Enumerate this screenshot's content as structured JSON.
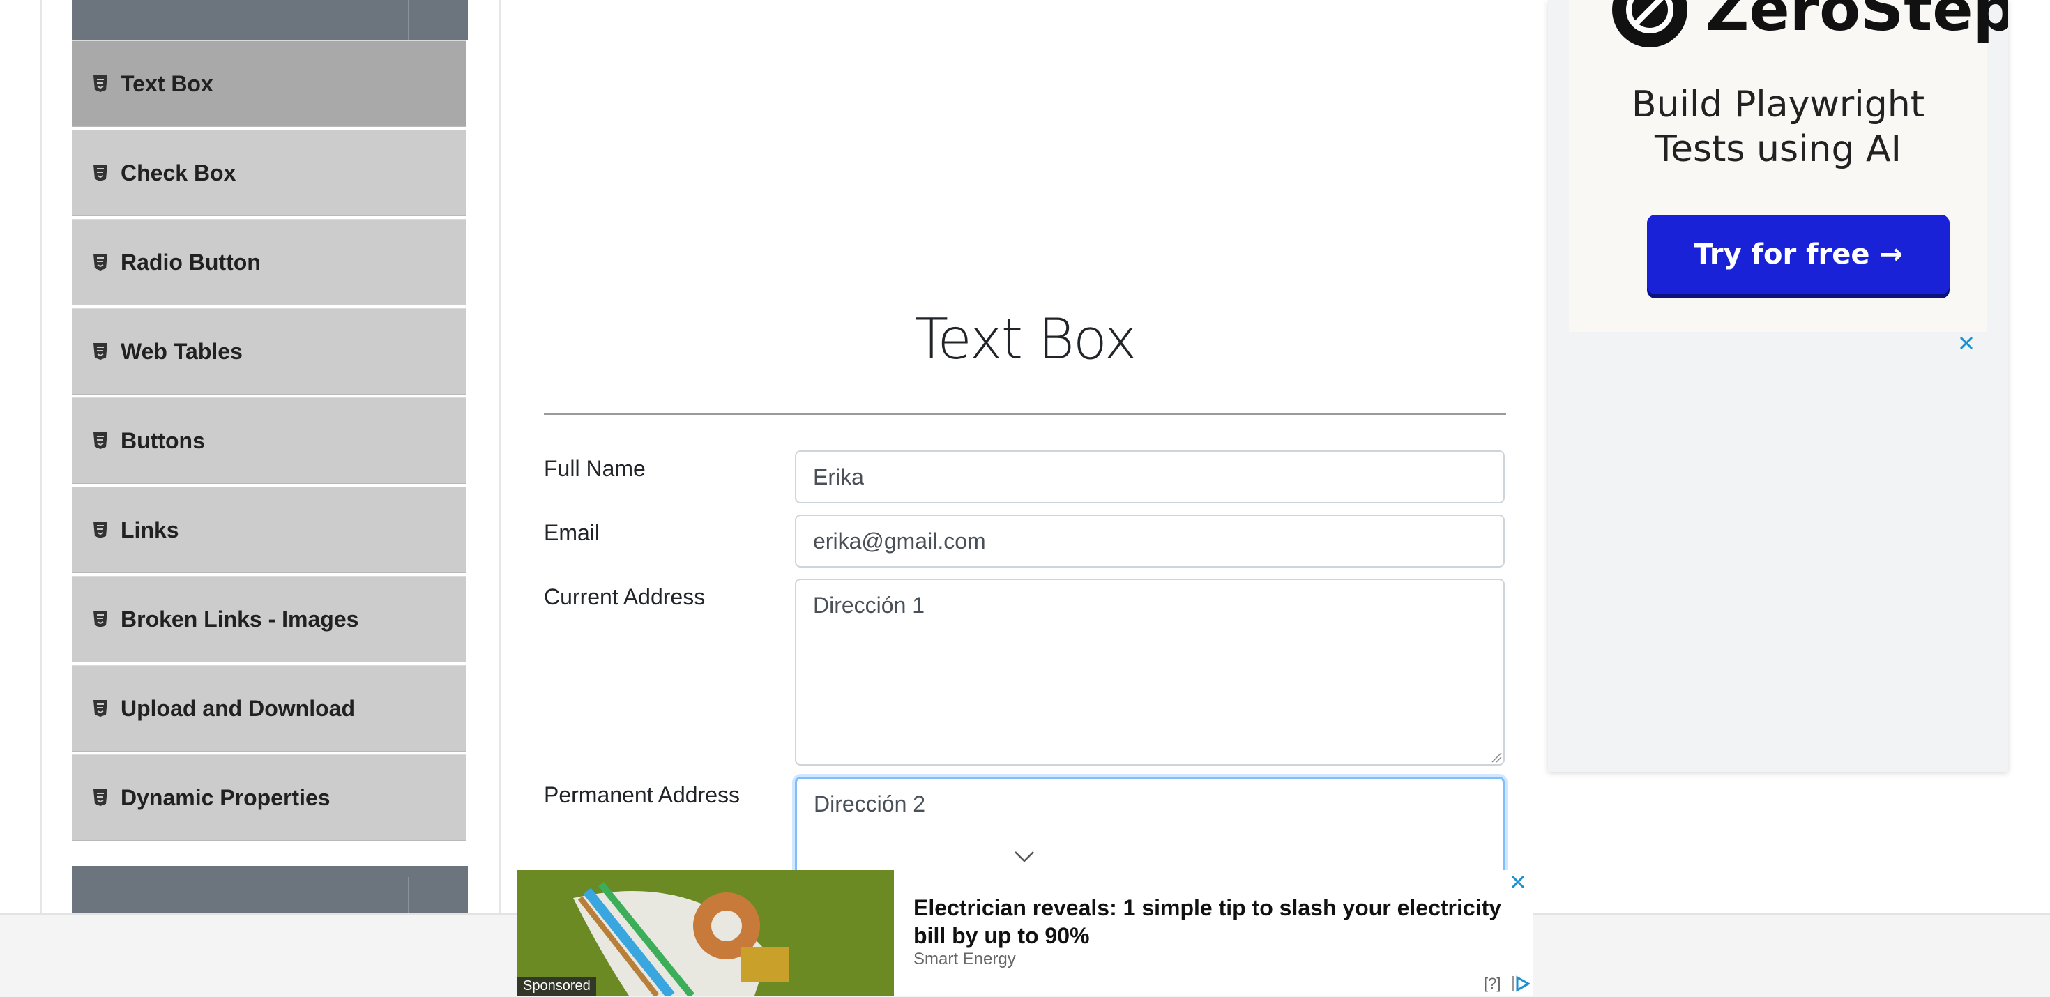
{
  "sidebar": {
    "items": [
      {
        "label": "Text Box",
        "active": true
      },
      {
        "label": "Check Box",
        "active": false
      },
      {
        "label": "Radio Button",
        "active": false
      },
      {
        "label": "Web Tables",
        "active": false
      },
      {
        "label": "Buttons",
        "active": false
      },
      {
        "label": "Links",
        "active": false
      },
      {
        "label": "Broken Links - Images",
        "active": false
      },
      {
        "label": "Upload and Download",
        "active": false
      },
      {
        "label": "Dynamic Properties",
        "active": false
      }
    ]
  },
  "main": {
    "title": "Text Box",
    "form": {
      "full_name_label": "Full Name",
      "full_name_value": "Erika",
      "email_label": "Email",
      "email_value": "erika@gmail.com",
      "current_address_label": "Current Address",
      "current_address_value": "Dirección 1",
      "permanent_address_label": "Permanent Address",
      "permanent_address_value": "Dirección 2"
    }
  },
  "ad_right": {
    "brand": "ZeroStep",
    "headline_line1": "Build Playwright",
    "headline_line2": "Tests using AI",
    "cta": "Try for free →"
  },
  "ad_bottom": {
    "sponsored": "Sponsored",
    "headline": "Electrician reveals: 1 simple tip to slash your electricity bill by up to 90%",
    "source": "Smart Energy",
    "help": "[?]"
  },
  "colors": {
    "menu_bg": "#cccccc",
    "menu_active_bg": "#a9a9a9",
    "group_header": "#6c757d",
    "focus_border": "#80bdff",
    "cta_blue": "#1a22d8"
  }
}
